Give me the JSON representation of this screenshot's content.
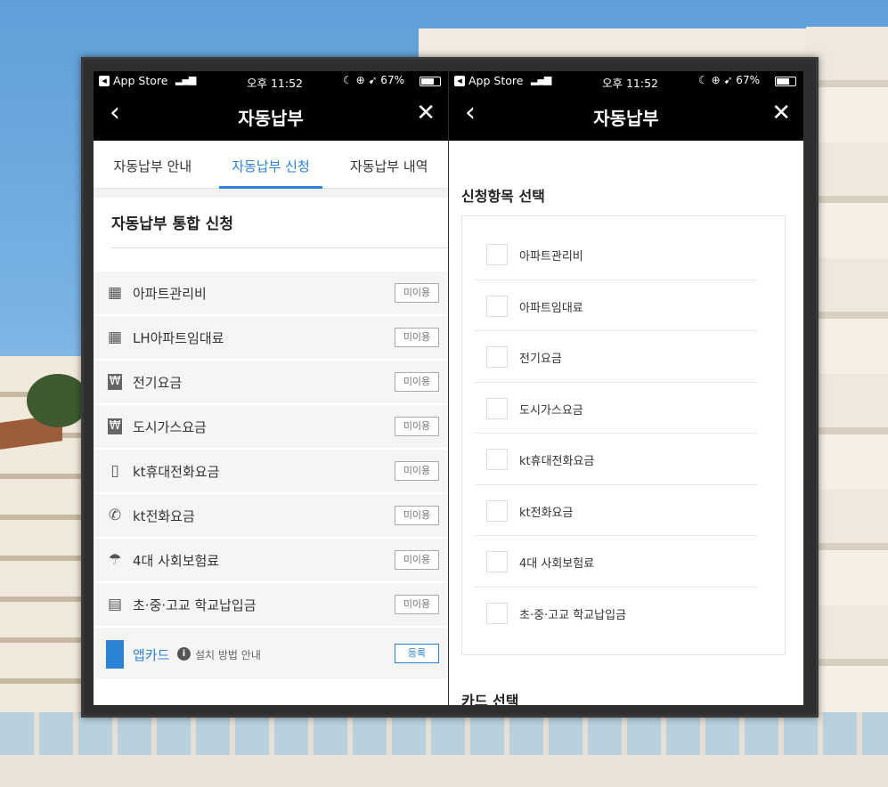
{
  "status_bar": {
    "back_app": "App Store",
    "signal": "▂▄▆",
    "wifi": "WiFi",
    "time": "오후 11:52",
    "right_icons": "☾ ⊕ ➹ 67%",
    "battery_percent": "67%"
  },
  "left": {
    "nav": {
      "back": "‹",
      "title": "자동납부",
      "close": "✕"
    },
    "tabs": [
      {
        "label": "자동납부 안내",
        "active": false
      },
      {
        "label": "자동납부 신청",
        "active": true
      },
      {
        "label": "자동납부 내역",
        "active": false
      }
    ],
    "section_title": "자동납부 통합 신청",
    "items": [
      {
        "icon": "building-icon",
        "label": "아파트관리비",
        "status": "미이용"
      },
      {
        "icon": "building-icon",
        "label": "LH아파트임대료",
        "status": "미이용"
      },
      {
        "icon": "electric-bill-icon",
        "label": "전기요금",
        "status": "미이용"
      },
      {
        "icon": "gas-bill-icon",
        "label": "도시가스요금",
        "status": "미이용"
      },
      {
        "icon": "mobile-phone-icon",
        "label": "kt휴대전화요금",
        "status": "미이용"
      },
      {
        "icon": "telephone-icon",
        "label": "kt전화요금",
        "status": "미이용"
      },
      {
        "icon": "umbrella-won-icon",
        "label": "4대 사회보험료",
        "status": "미이용"
      },
      {
        "icon": "school-doc-icon",
        "label": "초·중·고교 학교납입금",
        "status": "미이용"
      }
    ],
    "appcard": {
      "label": "앱카드",
      "info": "설치 방법 안내",
      "button": "등록"
    }
  },
  "right": {
    "nav": {
      "back": "‹",
      "title": "자동납부",
      "close": "✕"
    },
    "section_title": "신청항목 선택",
    "items": [
      "아파트관리비",
      "아파트임대료",
      "전기요금",
      "도시가스요금",
      "kt휴대전화요금",
      "kt전화요금",
      "4대 사회보험료",
      "초·중·고교 학교납입금"
    ],
    "next_section": "카드 선택"
  },
  "colors": {
    "accent": "#2c82d4",
    "navbar": "#000000"
  }
}
